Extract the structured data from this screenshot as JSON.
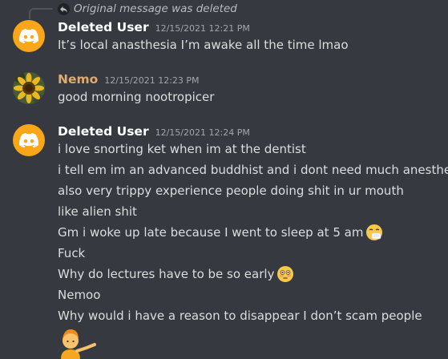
{
  "reply": {
    "text": "Original message was deleted",
    "icon": "reply-arrow-icon"
  },
  "messages": [
    {
      "author": "Deleted User",
      "timestamp": "12/15/2021 12:21 PM",
      "avatar": "discord-logo-icon",
      "lines": [
        "It’s local anasthesia I’m awake all the time lmao"
      ]
    },
    {
      "author": "Nemo",
      "timestamp": "12/15/2021 12:23 PM",
      "avatar": "sunflower-avatar",
      "author_color": "#e0a96d",
      "lines": [
        "good morning nootropicer"
      ]
    },
    {
      "author": "Deleted User",
      "timestamp": "12/15/2021 12:24 PM",
      "avatar": "discord-logo-icon",
      "lines": [
        "i love snorting ket when im at the dentist",
        "i tell em im an advanced buddhist and i dont need much anesthesia",
        "also very trippy experience people doing shit in ur mouth",
        "like alien shit",
        "Gm i woke up late because I went to sleep at 5 am",
        "Fuck",
        "Why do lectures have to be so early",
        "Nemoo",
        "Why would i have a reason to disappear I don’t scam people"
      ],
      "emojis": {
        "line4": "sneezing-face-emoji",
        "line6": "flushed-face-emoji",
        "last": "person-tipping-hand-emoji"
      }
    }
  ],
  "colors": {
    "background": "#36393f",
    "discord_avatar": "#faa61a",
    "text": "#dcddde"
  }
}
